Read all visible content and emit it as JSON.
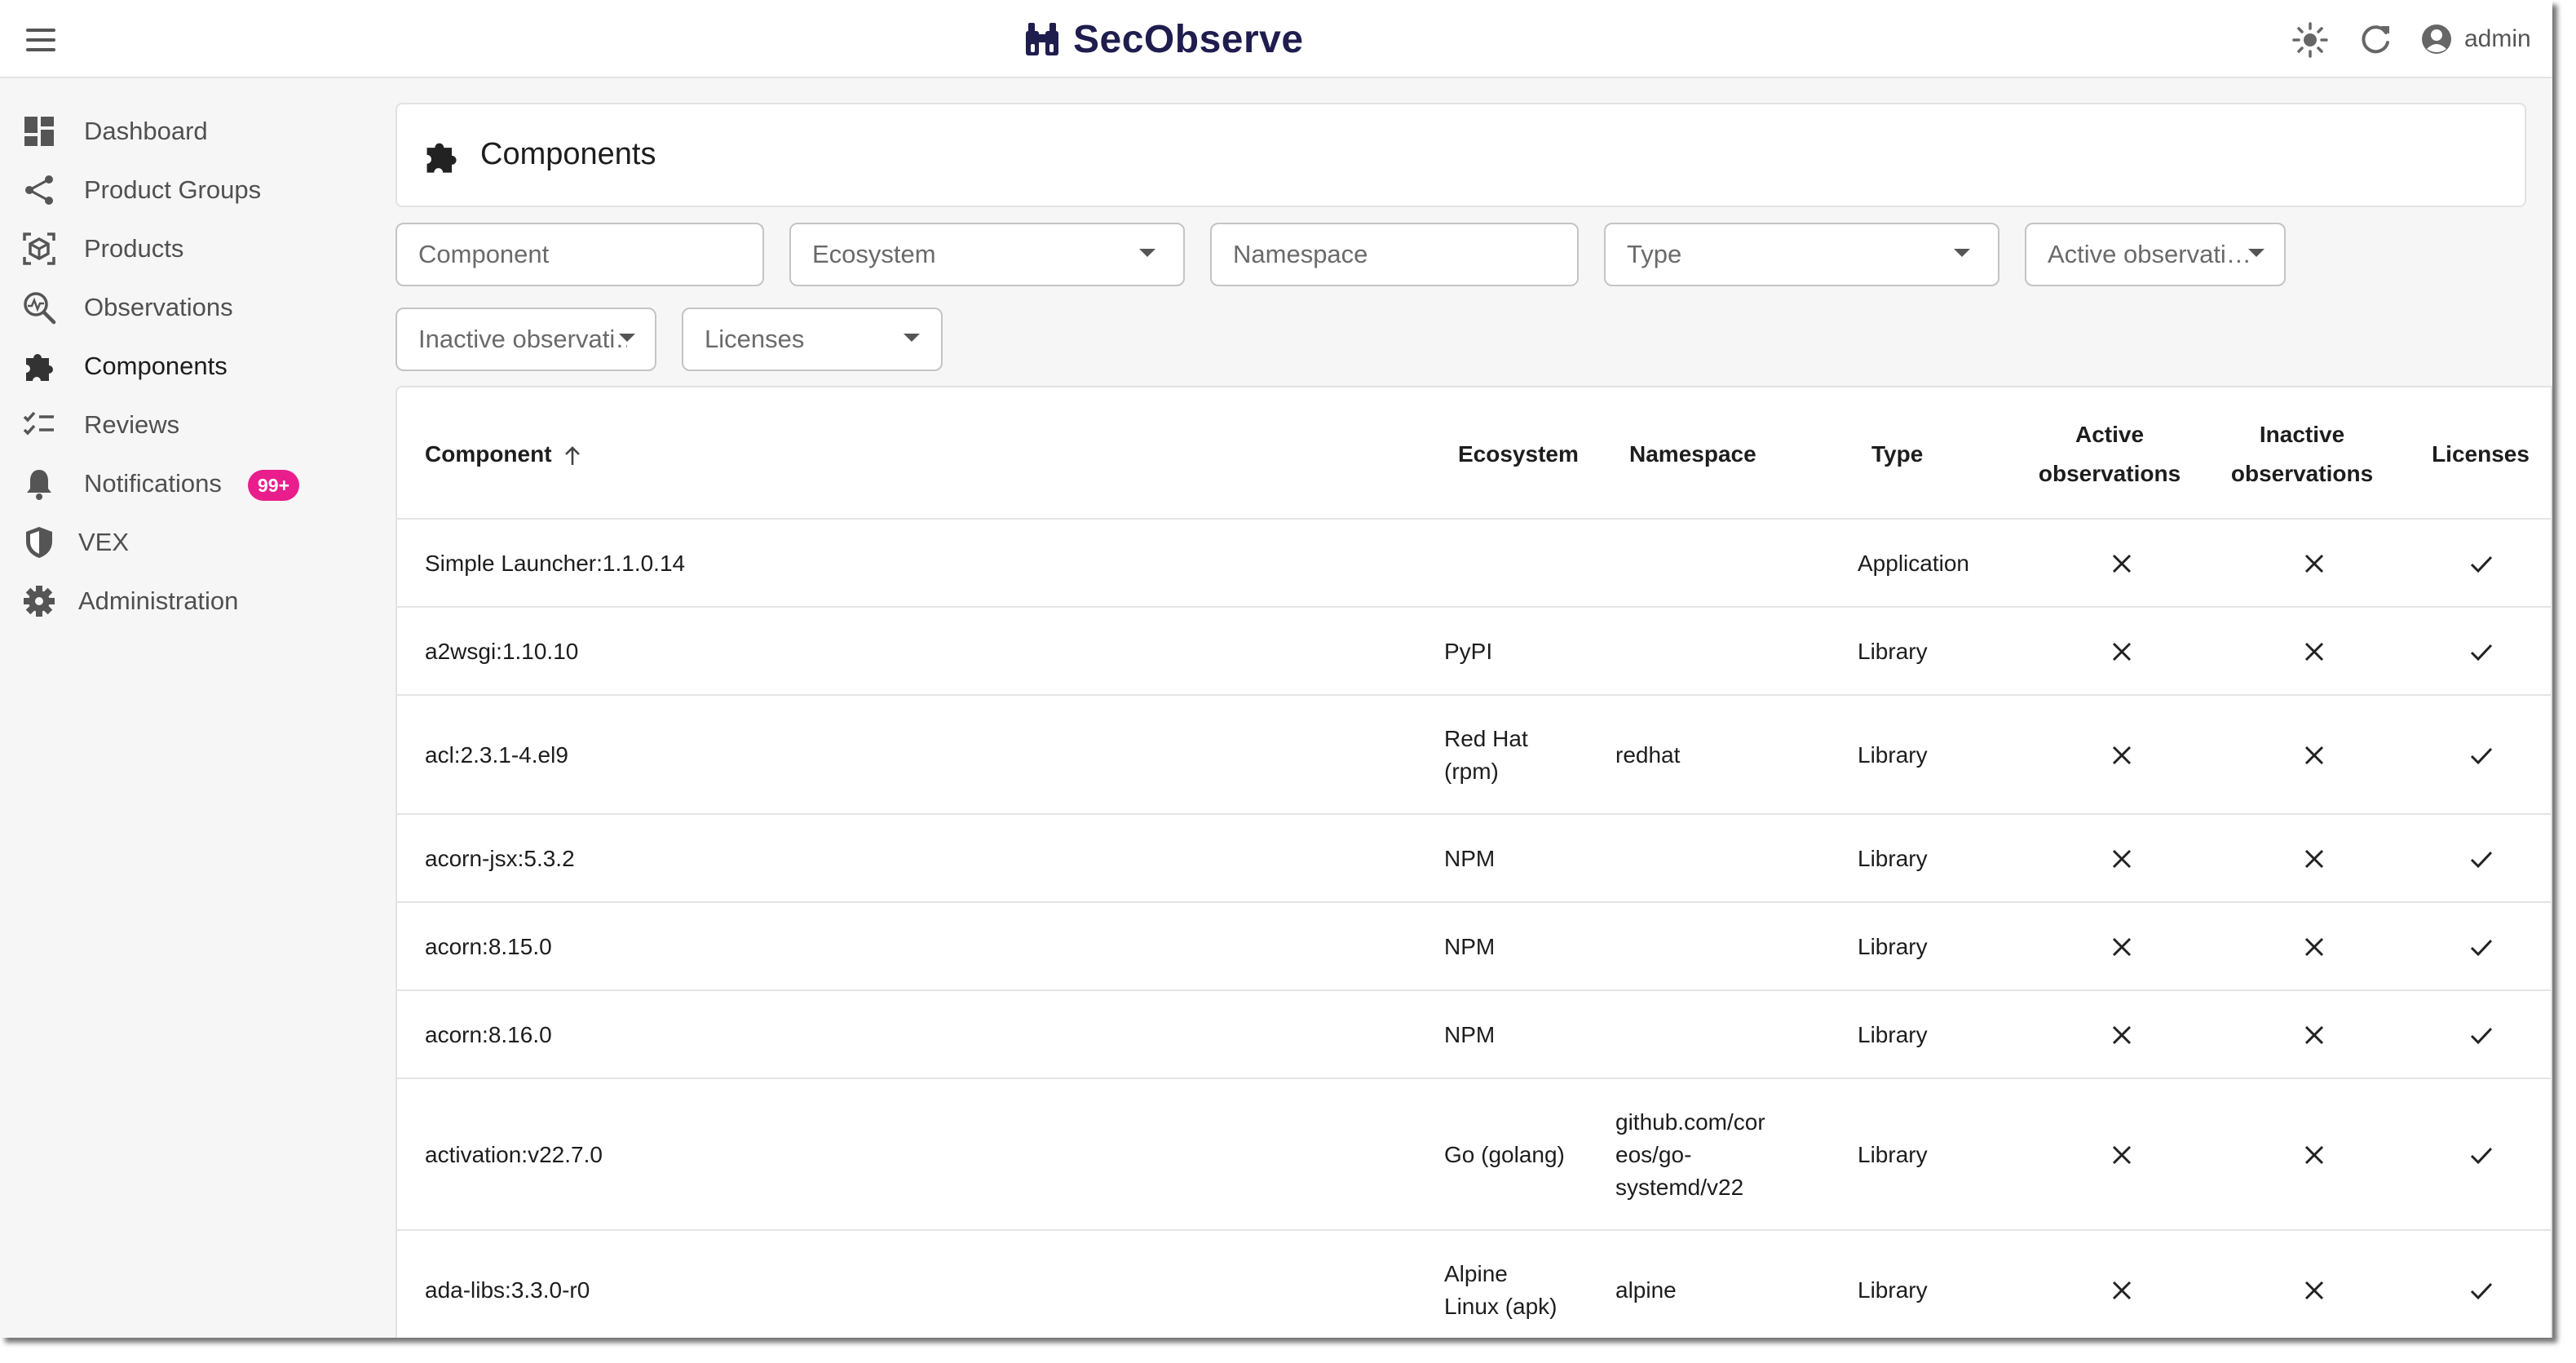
{
  "app": {
    "title": "SecObserve",
    "user": "admin"
  },
  "colors": {
    "brand": "#1f1d4e",
    "badge": "#e91e8c"
  },
  "topbar": {
    "icons": [
      "menu-icon",
      "sun-icon",
      "refresh-icon",
      "account-icon"
    ]
  },
  "sidebar": {
    "items": [
      {
        "label": "Dashboard",
        "icon": "dashboard-icon"
      },
      {
        "label": "Product Groups",
        "icon": "share-icon"
      },
      {
        "label": "Products",
        "icon": "product-icon"
      },
      {
        "label": "Observations",
        "icon": "observation-icon"
      },
      {
        "label": "Components",
        "icon": "puzzle-icon",
        "active": true
      },
      {
        "label": "Reviews",
        "icon": "checklist-icon"
      },
      {
        "label": "Notifications",
        "icon": "bell-icon",
        "badge": "99+"
      },
      {
        "label": "VEX",
        "icon": "shield-icon"
      },
      {
        "label": "Administration",
        "icon": "gear-icon"
      }
    ]
  },
  "page": {
    "title": "Components"
  },
  "filters": {
    "component": "Component",
    "ecosystem": "Ecosystem",
    "namespace": "Namespace",
    "type": "Type",
    "active_observations": "Active observati…",
    "inactive_observations": "Inactive observati…",
    "licenses": "Licenses"
  },
  "table": {
    "headers": {
      "component": "Component",
      "ecosystem": "Ecosystem",
      "namespace": "Namespace",
      "type": "Type",
      "active_1": "Active",
      "active_2": "observations",
      "inactive_1": "Inactive",
      "inactive_2": "observations",
      "licenses": "Licenses"
    },
    "rows": [
      {
        "component": "Simple Launcher:1.1.0.14",
        "ecosystem": "",
        "namespace": "",
        "type": "Application",
        "active": false,
        "inactive": false,
        "licenses": true
      },
      {
        "component": "a2wsgi:1.10.10",
        "ecosystem": "PyPI",
        "namespace": "",
        "type": "Library",
        "active": false,
        "inactive": false,
        "licenses": true
      },
      {
        "component": "acl:2.3.1-4.el9",
        "ecosystem": "Red Hat (rpm)",
        "namespace": "redhat",
        "type": "Library",
        "active": false,
        "inactive": false,
        "licenses": true
      },
      {
        "component": "acorn-jsx:5.3.2",
        "ecosystem": "NPM",
        "namespace": "",
        "type": "Library",
        "active": false,
        "inactive": false,
        "licenses": true
      },
      {
        "component": "acorn:8.15.0",
        "ecosystem": "NPM",
        "namespace": "",
        "type": "Library",
        "active": false,
        "inactive": false,
        "licenses": true
      },
      {
        "component": "acorn:8.16.0",
        "ecosystem": "NPM",
        "namespace": "",
        "type": "Library",
        "active": false,
        "inactive": false,
        "licenses": true
      },
      {
        "component": "activation:v22.7.0",
        "ecosystem": "Go (golang)",
        "namespace": "github.com/coreos/go-systemd/v22",
        "type": "Library",
        "active": false,
        "inactive": false,
        "licenses": true
      },
      {
        "component": "ada-libs:3.3.0-r0",
        "ecosystem": "Alpine Linux (apk)",
        "namespace": "alpine",
        "type": "Library",
        "active": false,
        "inactive": false,
        "licenses": true
      }
    ]
  }
}
